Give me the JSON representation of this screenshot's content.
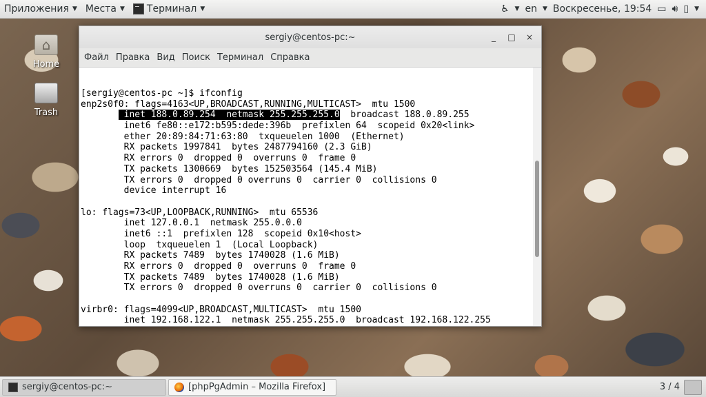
{
  "top_panel": {
    "applications": "Приложения",
    "places": "Места",
    "active_app": "Терминал",
    "accessibility_icon": "accessibility-icon",
    "keyboard_layout": "en",
    "clock": "Воскресенье, 19:54",
    "tray_icons": [
      "display-icon",
      "volume-icon",
      "battery-icon"
    ]
  },
  "desktop_icons": [
    {
      "label": "Home",
      "icon": "home-folder-icon"
    },
    {
      "label": "Trash",
      "icon": "trash-icon"
    }
  ],
  "window": {
    "title": "sergiy@centos-pc:~",
    "controls": [
      "_",
      "□",
      "×"
    ],
    "menu": [
      "Файл",
      "Правка",
      "Вид",
      "Поиск",
      "Терминал",
      "Справка"
    ]
  },
  "terminal": {
    "lines": [
      "[sergiy@centos-pc ~]$ ifconfig",
      "enp2s0f0: flags=4163<UP,BROADCAST,RUNNING,MULTICAST>  mtu 1500",
      "__HL__",
      "        inet6 fe80::e172:b595:dede:396b  prefixlen 64  scopeid 0x20<link>",
      "        ether 20:89:84:71:63:80  txqueuelen 1000  (Ethernet)",
      "        RX packets 1997841  bytes 2487794160 (2.3 GiB)",
      "        RX errors 0  dropped 0  overruns 0  frame 0",
      "        TX packets 1300669  bytes 152503564 (145.4 MiB)",
      "        TX errors 0  dropped 0 overruns 0  carrier 0  collisions 0",
      "        device interrupt 16",
      "",
      "lo: flags=73<UP,LOOPBACK,RUNNING>  mtu 65536",
      "        inet 127.0.0.1  netmask 255.0.0.0",
      "        inet6 ::1  prefixlen 128  scopeid 0x10<host>",
      "        loop  txqueuelen 1  (Local Loopback)",
      "        RX packets 7489  bytes 1740028 (1.6 MiB)",
      "        RX errors 0  dropped 0  overruns 0  frame 0",
      "        TX packets 7489  bytes 1740028 (1.6 MiB)",
      "        TX errors 0  dropped 0 overruns 0  carrier 0  collisions 0",
      "",
      "virbr0: flags=4099<UP,BROADCAST,MULTICAST>  mtu 1500",
      "        inet 192.168.122.1  netmask 255.255.255.0  broadcast 192.168.122.255"
    ],
    "highlight_line": {
      "indent": "       ",
      "selected": " inet 188.0.89.254  netmask 255.255.255.0",
      "rest": "  broadcast 188.0.89.255"
    }
  },
  "taskbar": {
    "tasks": [
      {
        "label": "sergiy@centos-pc:~",
        "icon": "terminal-icon",
        "active": true
      },
      {
        "label": "[phpPgAdmin – Mozilla Firefox]",
        "icon": "firefox-icon",
        "active": false
      }
    ],
    "workspace": "3 / 4"
  }
}
